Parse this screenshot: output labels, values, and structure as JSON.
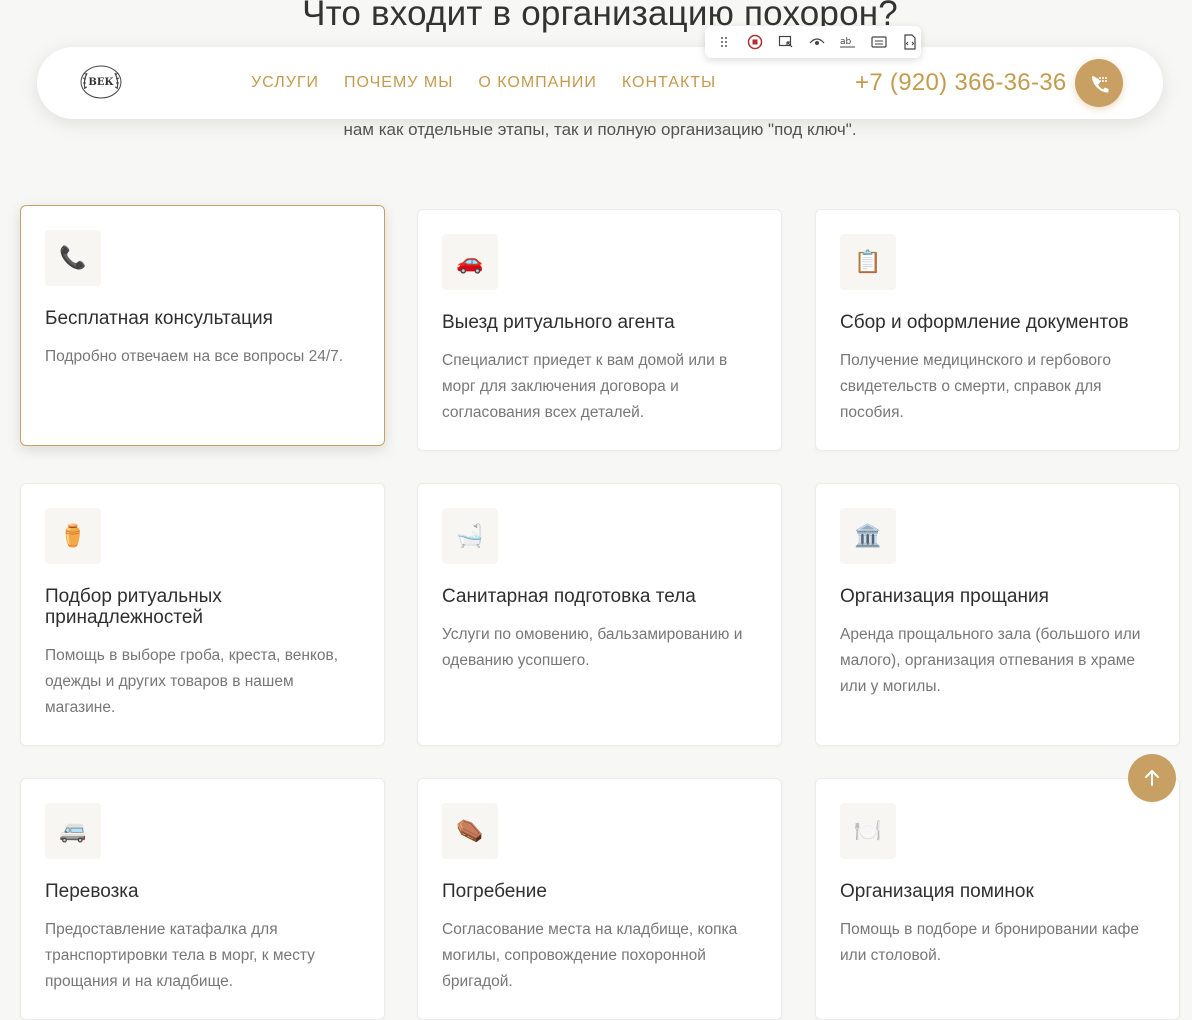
{
  "section": {
    "title": "Что входит в организацию похорон?",
    "subtitle": "нам как отдельные этапы, так и полную организацию \"под ключ\"."
  },
  "header": {
    "logo_text": "ВЕК",
    "nav": [
      {
        "label": "УСЛУГИ"
      },
      {
        "label": "ПОЧЕМУ МЫ"
      },
      {
        "label": "О КОМПАНИИ"
      },
      {
        "label": "КОНТАКТЫ"
      }
    ],
    "phone": "+7 (920) 366-36-36"
  },
  "colors": {
    "accent": "#c8a063",
    "nav_text": "#c49b4e",
    "background": "#f7f7f6"
  },
  "toolbar": {
    "icons": [
      "drag-handle-icon",
      "record-icon",
      "select-element-icon",
      "eye-icon",
      "text-spellcheck-icon",
      "caption-icon",
      "code-file-icon"
    ]
  },
  "cards": [
    {
      "icon": "📞",
      "icon_name": "telephone-icon",
      "title": "Бесплатная консультация",
      "desc": "Подробно отвечаем на все вопросы 24/7."
    },
    {
      "icon": "🚗",
      "icon_name": "car-icon",
      "title": "Выезд ритуального агента",
      "desc": "Специалист приедет к вам домой или в морг для заключения договора и согласования всех деталей."
    },
    {
      "icon": "📋",
      "icon_name": "clipboard-icon",
      "title": "Сбор и оформление документов",
      "desc": "Получение медицинского и гербового свидетельств о смерти, справок для пособия."
    },
    {
      "icon": "⚱️",
      "icon_name": "urn-icon",
      "title": "Подбор ритуальных принадлежностей",
      "desc": "Помощь в выборе гроба, креста, венков, одежды и других товаров в нашем магазине."
    },
    {
      "icon": "🛁",
      "icon_name": "bathtub-icon",
      "title": "Санитарная подготовка тела",
      "desc": "Услуги по омовению, бальзамированию и одеванию усопшего."
    },
    {
      "icon": "🏛️",
      "icon_name": "classical-building-icon",
      "title": "Организация прощания",
      "desc": "Аренда прощального зала (большого или малого), организация отпевания в храме или у могилы."
    },
    {
      "icon": "🚐",
      "icon_name": "minibus-icon",
      "title": "Перевозка",
      "desc": "Предоставление катафалка для транспортировки тела в морг, к месту прощания и на кладбище."
    },
    {
      "icon": "⚰️",
      "icon_name": "coffin-icon",
      "title": "Погребение",
      "desc": "Согласование места на кладбище, копка могилы, сопровождение похоронной бригадой."
    },
    {
      "icon": "🍽️",
      "icon_name": "plate-cutlery-icon",
      "title": "Организация поминок",
      "desc": "Помощь в подборе и бронировании кафе или столовой."
    }
  ]
}
